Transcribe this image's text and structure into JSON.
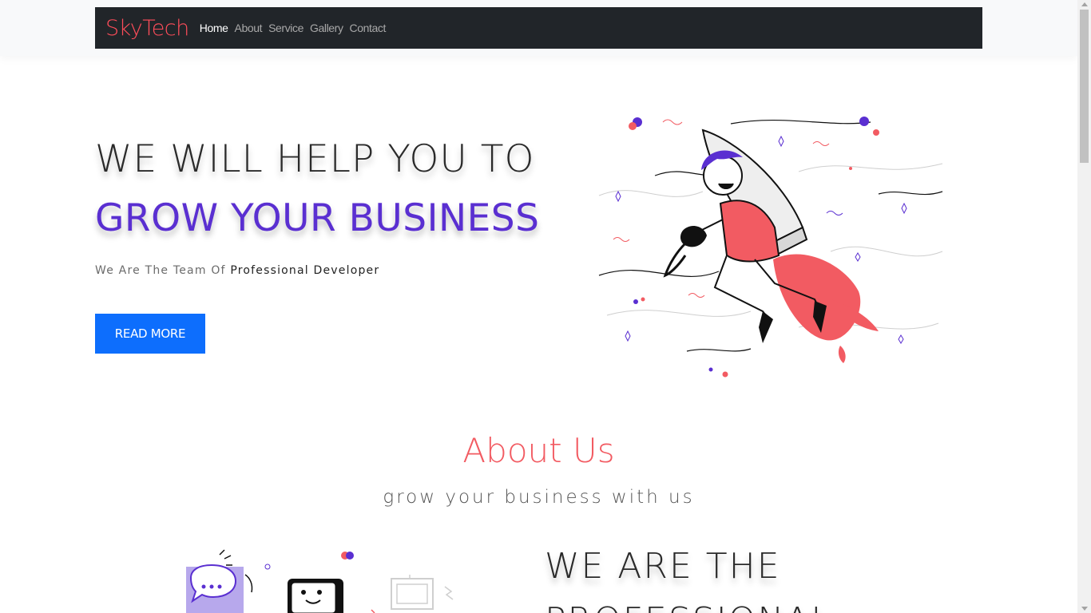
{
  "navbar": {
    "brand": "SkyTech",
    "links": [
      "Home",
      "About",
      "Service",
      "Gallery",
      "Contact"
    ],
    "active": "Home"
  },
  "hero": {
    "line1": "WE WILL HELP YOU TO",
    "line2": "GROW YOUR BUSINESS",
    "subtitle_pre": "We Are The Team Of ",
    "subtitle_strong": "Professional Developer",
    "button_label": "READ MORE",
    "illustration_icon": "rocket-boy-illustration"
  },
  "about": {
    "title": "About Us",
    "subtitle": "grow your business with us",
    "heading_line1": "WE ARE THE",
    "heading_line2": "PROFESSIONAL",
    "illustration_icon": "robot-chat-illustration"
  },
  "colors": {
    "brand": "#ff4d5a",
    "navbar_bg": "#212529",
    "accent_purple": "#5a2fd1",
    "button_blue": "#0d6efd",
    "about_title": "#f25b62"
  }
}
